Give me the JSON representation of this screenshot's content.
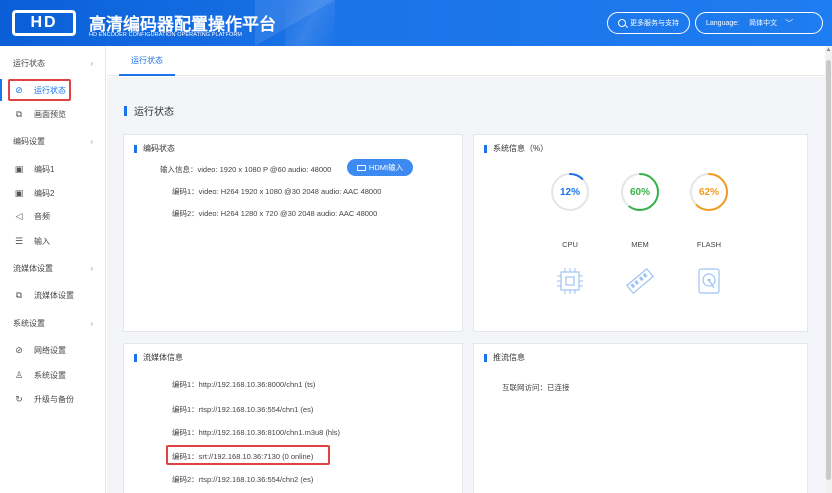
{
  "header": {
    "logo_text": "HD",
    "title_cn": "高清编码器配置操作平台",
    "title_en": "HD ENCODER CONFIGURATION OPERATING PLATFORM",
    "service_label": "更多服务与支持",
    "language_label": "Language:",
    "language_value": "简体中文"
  },
  "sidebar": {
    "groups": [
      {
        "label": "运行状态"
      },
      {
        "label": "编码设置"
      },
      {
        "label": "流媒体设置"
      },
      {
        "label": "系统设置"
      }
    ],
    "items": [
      {
        "label": "运行状态",
        "icon": "status-icon"
      },
      {
        "label": "画面预览",
        "icon": "preview-icon"
      },
      {
        "label": "编码1",
        "icon": "encoder-icon"
      },
      {
        "label": "编码2",
        "icon": "encoder-icon"
      },
      {
        "label": "音频",
        "icon": "audio-icon"
      },
      {
        "label": "输入",
        "icon": "input-icon"
      },
      {
        "label": "流媒体设置",
        "icon": "stream-icon"
      },
      {
        "label": "网络设置",
        "icon": "network-icon"
      },
      {
        "label": "系统设置",
        "icon": "user-icon"
      },
      {
        "label": "升级与备份",
        "icon": "refresh-icon"
      }
    ]
  },
  "tabs": [
    {
      "label": "运行状态"
    }
  ],
  "main": {
    "page_title": "运行状态",
    "encode_status": {
      "title": "编码状态",
      "input_info": "输入信息：video: 1920 x 1080 P @60 audio: 48000",
      "hdmi_label": "HDMI输入",
      "enc1": "编码1：video: H264 1920 x 1080 @30 2048 audio: AAC 48000",
      "enc2": "编码2：video: H264 1280 x 720 @30 2048 audio: AAC 48000"
    },
    "system_info": {
      "title": "系统信息（%）",
      "cpu": {
        "label": "CPU",
        "value": "12%",
        "percent": 12,
        "color": "#1a73e8"
      },
      "mem": {
        "label": "MEM",
        "value": "60%",
        "percent": 60,
        "color": "#35b34a"
      },
      "flash": {
        "label": "FLASH",
        "value": "62%",
        "percent": 62,
        "color": "#f39a1e"
      }
    },
    "stream_info": {
      "title": "流媒体信息",
      "rows": [
        "编码1：http://192.168.10.36:8000/chn1 (ts)",
        "编码1：rtsp://192.168.10.36:554/chn1 (es)",
        "编码1：http://192.168.10.36:8100/chn1.m3u8 (hls)",
        "编码1：srt://192.168.10.36:7130 (0 online)",
        "编码2：rtsp://192.168.10.36:554/chn2 (es)"
      ]
    },
    "push_info": {
      "title": "推流信息",
      "internet": "互联网访问：已连接"
    }
  }
}
